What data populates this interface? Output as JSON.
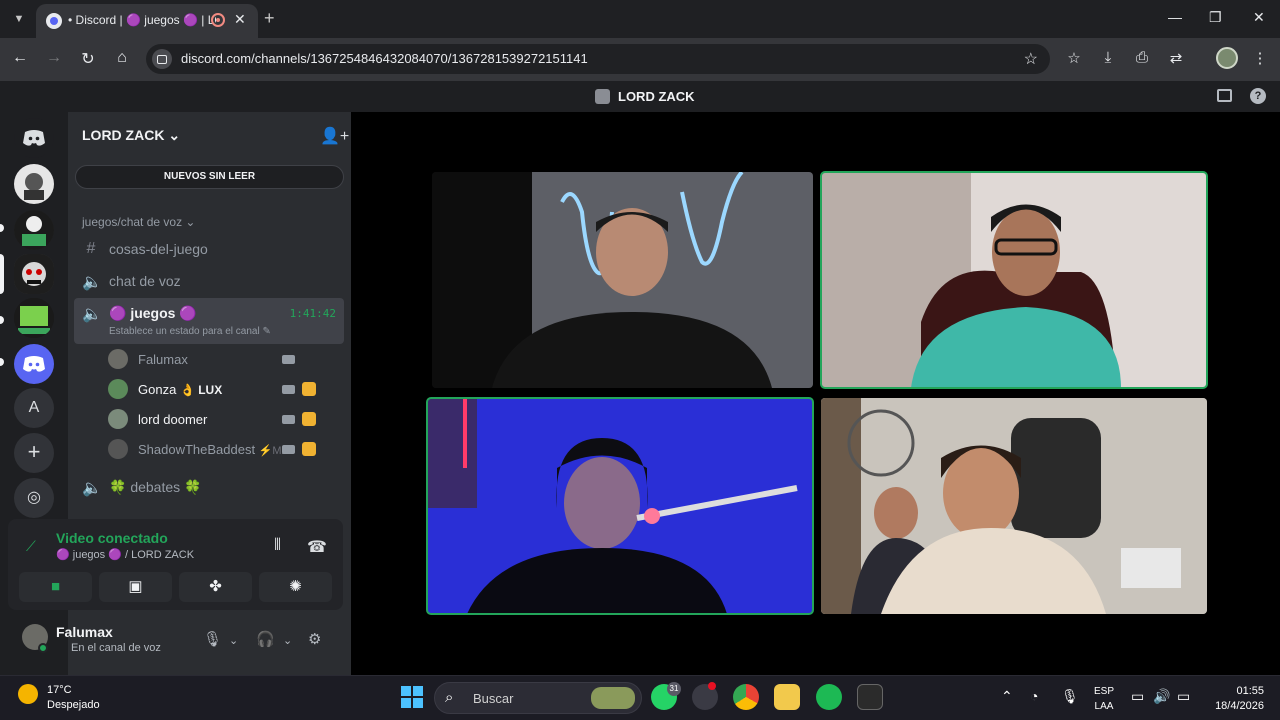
{
  "browser": {
    "tab_title": "• Discord | 🟣 juegos 🟣 | LORD ZACK",
    "url": "discord.com/channels/1367254846432084070/1367281539272151141",
    "new_tab": "+",
    "close_tab": "✕"
  },
  "discord": {
    "title": "LORD ZACK",
    "guild_name": "LORD ZACK",
    "guild_chevron": "⌄",
    "unread_button": "NUEVOS SIN LEER",
    "category": "juegos/chat de voz",
    "channels": [
      {
        "icon": "#",
        "name": "cosas-del-juego"
      },
      {
        "icon": "🔈",
        "name": "chat de voz"
      }
    ],
    "active_channel": {
      "name": "🟣 juegos 🟣",
      "status": "Establece un estado para el canal ✎",
      "time": "1:41:42"
    },
    "voice_users": [
      {
        "name": "Falumax"
      },
      {
        "name": "Gonza",
        "badge": "👌 LUX"
      },
      {
        "name": "lord doomer"
      },
      {
        "name": "ShadowTheBaddest",
        "badge": "⚡MZ"
      }
    ],
    "debates_channel": "🍀 debates 🍀",
    "rail_letter": "A",
    "rail_add": "+",
    "voice_panel": {
      "title": "Video conectado",
      "subtitle": "🟣 juegos 🟣 / LORD ZACK"
    },
    "user": {
      "name": "Falumax",
      "status": "En el canal de voz"
    }
  },
  "taskbar": {
    "weather_temp": "17°C",
    "weather_desc": "Despejado",
    "search_label": "Buscar",
    "whatsapp_badge": "31",
    "lang_top": "ESP",
    "lang_bottom": "LAA",
    "time": "01:55",
    "date": "18/4/2026"
  },
  "colors": {
    "accent_green": "#23a55a",
    "discord_blurple": "#5865f2"
  }
}
